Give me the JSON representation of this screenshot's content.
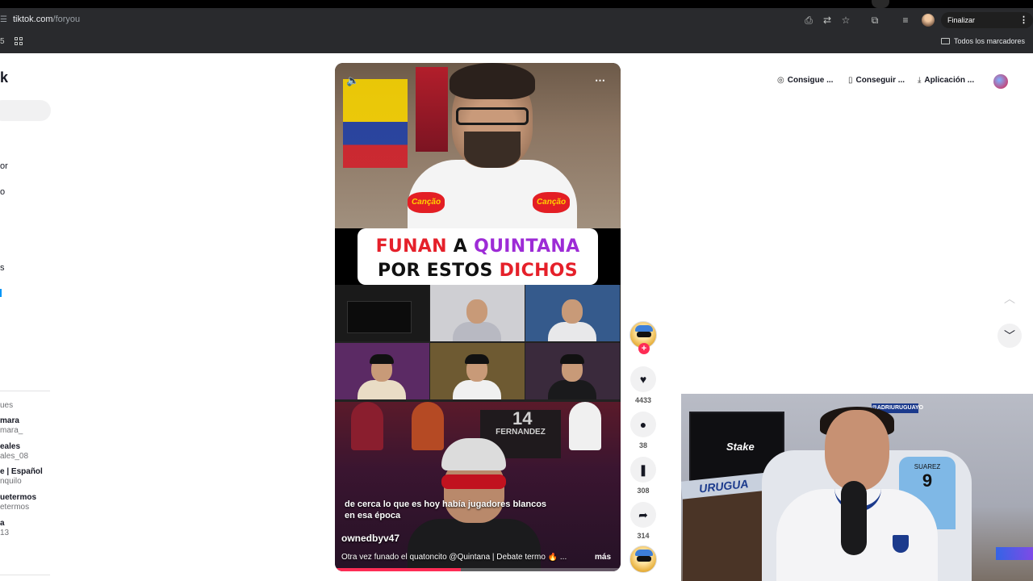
{
  "browser": {
    "url_host": "tiktok.com",
    "url_path": "/foryou",
    "update_button": "Finalizar actualización",
    "bookmarks_folder": "Todos los marcadores",
    "left_fragment": "5"
  },
  "sidebar": {
    "logo_fragment": "k",
    "nav_fragments": [
      "or",
      "o",
      "s"
    ],
    "following_header": "ues",
    "accounts": [
      {
        "name": "mara",
        "handle": "mara_"
      },
      {
        "name": "eales",
        "handle": "ales_08"
      },
      {
        "name": "e | Español",
        "handle": "nquilo"
      },
      {
        "name": "uetermos",
        "handle": "etermos"
      },
      {
        "name": "a",
        "handle": "13"
      }
    ]
  },
  "top_actions": {
    "item1": "Consigue ...",
    "item2": "Conseguir ...",
    "item3": "Aplicación ..."
  },
  "video": {
    "title_line1_a": "FUNAN",
    "title_line1_b": "A",
    "title_line1_c": "QUINTANA",
    "title_line2_a": "POR ESTOS",
    "title_line2_b": "DICHOS",
    "badge_text": "Canção",
    "jersey_name": "FERNANDEZ",
    "jersey_number": "14",
    "caption": "de cerca lo que es hoy había jugadores blancos en esa época",
    "username": "ownedbyv47",
    "description": "Otra vez funado el quatoncito @Quintana | Debate termo 🔥 ...",
    "more": "más",
    "progress": 0.44
  },
  "actions": {
    "likes": "4433",
    "comments": "38",
    "saves": "308",
    "shares": "314"
  },
  "webcam": {
    "tv_brand": "Stake",
    "tag": "@ADRIURUGUAYO",
    "banner": "URUGUA",
    "jersey_name": "SUAREZ",
    "jersey_number": "9"
  },
  "colors": {
    "tiktok_red": "#fe2c55",
    "title_red": "#e5202a",
    "title_purple": "#9d2bd6",
    "chrome_bar": "#292a2d"
  },
  "icons": {
    "mute": "speaker-icon",
    "more": "more-dots-icon",
    "like": "heart-icon",
    "comment": "comment-icon",
    "save": "bookmark-icon",
    "share": "share-arrow-icon",
    "up": "chevron-up-icon",
    "down": "chevron-down-icon"
  }
}
